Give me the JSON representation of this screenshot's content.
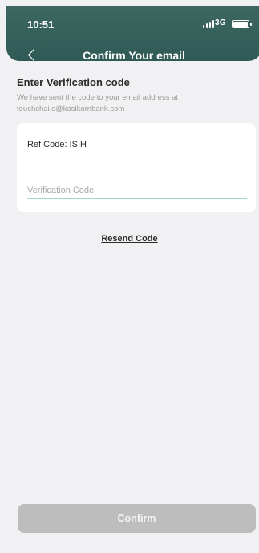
{
  "status_bar": {
    "time": "10:51",
    "network": "3G",
    "icons": [
      "signal-icon",
      "battery-icon"
    ]
  },
  "header": {
    "title": "Confirm Your email",
    "back_icon": "chevron-left-icon",
    "background_color": "#2f5a55"
  },
  "content": {
    "title": "Enter Verification code",
    "description": "We have sent the code to your email address at touchchai.s@kasikornbank.com"
  },
  "verification_card": {
    "ref_code": "Ref Code: ISIH",
    "code_input": {
      "value": "",
      "placeholder": "Verification Code"
    }
  },
  "resend_label": "Resend Code",
  "footer": {
    "confirm_label": "Confirm",
    "confirm_disabled": true
  },
  "colors": {
    "background": "#f1f1f3",
    "input_underline": "#9ed8cf",
    "disabled_button": "#bdbdbd"
  }
}
